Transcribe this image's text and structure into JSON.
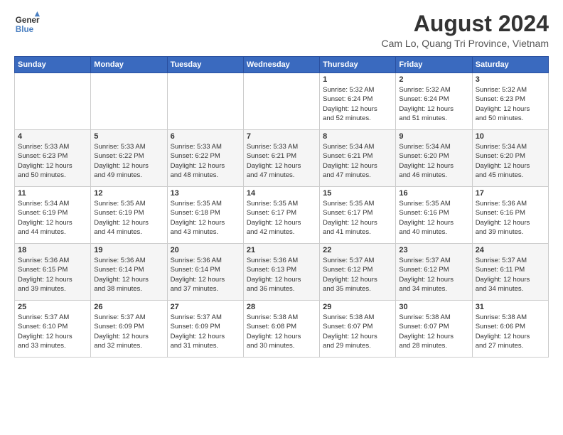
{
  "header": {
    "logo_line1": "General",
    "logo_line2": "Blue",
    "main_title": "August 2024",
    "sub_title": "Cam Lo, Quang Tri Province, Vietnam"
  },
  "calendar": {
    "days_of_week": [
      "Sunday",
      "Monday",
      "Tuesday",
      "Wednesday",
      "Thursday",
      "Friday",
      "Saturday"
    ],
    "weeks": [
      [
        {
          "day": "",
          "info": ""
        },
        {
          "day": "",
          "info": ""
        },
        {
          "day": "",
          "info": ""
        },
        {
          "day": "",
          "info": ""
        },
        {
          "day": "1",
          "info": "Sunrise: 5:32 AM\nSunset: 6:24 PM\nDaylight: 12 hours\nand 52 minutes."
        },
        {
          "day": "2",
          "info": "Sunrise: 5:32 AM\nSunset: 6:24 PM\nDaylight: 12 hours\nand 51 minutes."
        },
        {
          "day": "3",
          "info": "Sunrise: 5:32 AM\nSunset: 6:23 PM\nDaylight: 12 hours\nand 50 minutes."
        }
      ],
      [
        {
          "day": "4",
          "info": "Sunrise: 5:33 AM\nSunset: 6:23 PM\nDaylight: 12 hours\nand 50 minutes."
        },
        {
          "day": "5",
          "info": "Sunrise: 5:33 AM\nSunset: 6:22 PM\nDaylight: 12 hours\nand 49 minutes."
        },
        {
          "day": "6",
          "info": "Sunrise: 5:33 AM\nSunset: 6:22 PM\nDaylight: 12 hours\nand 48 minutes."
        },
        {
          "day": "7",
          "info": "Sunrise: 5:33 AM\nSunset: 6:21 PM\nDaylight: 12 hours\nand 47 minutes."
        },
        {
          "day": "8",
          "info": "Sunrise: 5:34 AM\nSunset: 6:21 PM\nDaylight: 12 hours\nand 47 minutes."
        },
        {
          "day": "9",
          "info": "Sunrise: 5:34 AM\nSunset: 6:20 PM\nDaylight: 12 hours\nand 46 minutes."
        },
        {
          "day": "10",
          "info": "Sunrise: 5:34 AM\nSunset: 6:20 PM\nDaylight: 12 hours\nand 45 minutes."
        }
      ],
      [
        {
          "day": "11",
          "info": "Sunrise: 5:34 AM\nSunset: 6:19 PM\nDaylight: 12 hours\nand 44 minutes."
        },
        {
          "day": "12",
          "info": "Sunrise: 5:35 AM\nSunset: 6:19 PM\nDaylight: 12 hours\nand 44 minutes."
        },
        {
          "day": "13",
          "info": "Sunrise: 5:35 AM\nSunset: 6:18 PM\nDaylight: 12 hours\nand 43 minutes."
        },
        {
          "day": "14",
          "info": "Sunrise: 5:35 AM\nSunset: 6:17 PM\nDaylight: 12 hours\nand 42 minutes."
        },
        {
          "day": "15",
          "info": "Sunrise: 5:35 AM\nSunset: 6:17 PM\nDaylight: 12 hours\nand 41 minutes."
        },
        {
          "day": "16",
          "info": "Sunrise: 5:35 AM\nSunset: 6:16 PM\nDaylight: 12 hours\nand 40 minutes."
        },
        {
          "day": "17",
          "info": "Sunrise: 5:36 AM\nSunset: 6:16 PM\nDaylight: 12 hours\nand 39 minutes."
        }
      ],
      [
        {
          "day": "18",
          "info": "Sunrise: 5:36 AM\nSunset: 6:15 PM\nDaylight: 12 hours\nand 39 minutes."
        },
        {
          "day": "19",
          "info": "Sunrise: 5:36 AM\nSunset: 6:14 PM\nDaylight: 12 hours\nand 38 minutes."
        },
        {
          "day": "20",
          "info": "Sunrise: 5:36 AM\nSunset: 6:14 PM\nDaylight: 12 hours\nand 37 minutes."
        },
        {
          "day": "21",
          "info": "Sunrise: 5:36 AM\nSunset: 6:13 PM\nDaylight: 12 hours\nand 36 minutes."
        },
        {
          "day": "22",
          "info": "Sunrise: 5:37 AM\nSunset: 6:12 PM\nDaylight: 12 hours\nand 35 minutes."
        },
        {
          "day": "23",
          "info": "Sunrise: 5:37 AM\nSunset: 6:12 PM\nDaylight: 12 hours\nand 34 minutes."
        },
        {
          "day": "24",
          "info": "Sunrise: 5:37 AM\nSunset: 6:11 PM\nDaylight: 12 hours\nand 34 minutes."
        }
      ],
      [
        {
          "day": "25",
          "info": "Sunrise: 5:37 AM\nSunset: 6:10 PM\nDaylight: 12 hours\nand 33 minutes."
        },
        {
          "day": "26",
          "info": "Sunrise: 5:37 AM\nSunset: 6:09 PM\nDaylight: 12 hours\nand 32 minutes."
        },
        {
          "day": "27",
          "info": "Sunrise: 5:37 AM\nSunset: 6:09 PM\nDaylight: 12 hours\nand 31 minutes."
        },
        {
          "day": "28",
          "info": "Sunrise: 5:38 AM\nSunset: 6:08 PM\nDaylight: 12 hours\nand 30 minutes."
        },
        {
          "day": "29",
          "info": "Sunrise: 5:38 AM\nSunset: 6:07 PM\nDaylight: 12 hours\nand 29 minutes."
        },
        {
          "day": "30",
          "info": "Sunrise: 5:38 AM\nSunset: 6:07 PM\nDaylight: 12 hours\nand 28 minutes."
        },
        {
          "day": "31",
          "info": "Sunrise: 5:38 AM\nSunset: 6:06 PM\nDaylight: 12 hours\nand 27 minutes."
        }
      ]
    ]
  }
}
